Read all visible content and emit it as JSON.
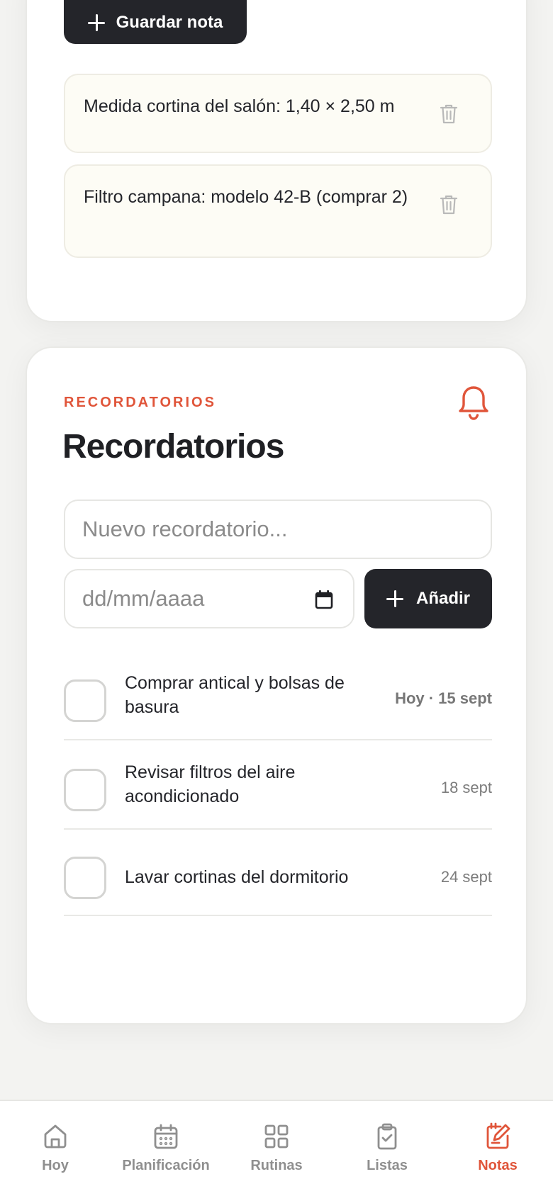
{
  "notes": {
    "save_label": "Guardar nota",
    "items": [
      {
        "text": "Medida cortina del salón: 1,40 × 2,50 m"
      },
      {
        "text": "Filtro campana: modelo 42-B (comprar 2)"
      }
    ]
  },
  "reminders": {
    "eyebrow": "RECORDATORIOS",
    "title": "Recordatorios",
    "new_placeholder": "Nuevo recordatorio...",
    "date_placeholder": "dd/mm/aaaa",
    "add_label": "Añadir",
    "items": [
      {
        "text": "Comprar antical y bolsas de basura",
        "date": "Hoy · 15 sept",
        "checked": false
      },
      {
        "text": "Revisar filtros del aire acondicionado",
        "date": "18 sept",
        "checked": false
      },
      {
        "text": "Lavar cortinas del dormitorio",
        "date": "24 sept",
        "checked": false
      }
    ]
  },
  "tabs": [
    {
      "label": "Hoy",
      "icon": "home-icon"
    },
    {
      "label": "Planificación",
      "icon": "calendar-icon"
    },
    {
      "label": "Rutinas",
      "icon": "grid-icon"
    },
    {
      "label": "Listas",
      "icon": "clipboard-check-icon"
    },
    {
      "label": "Notas",
      "icon": "notepad-pencil-icon",
      "active": true
    }
  ],
  "colors": {
    "accent": "#e0553a",
    "dark_button": "#24252a",
    "background": "#f3f3f1"
  }
}
